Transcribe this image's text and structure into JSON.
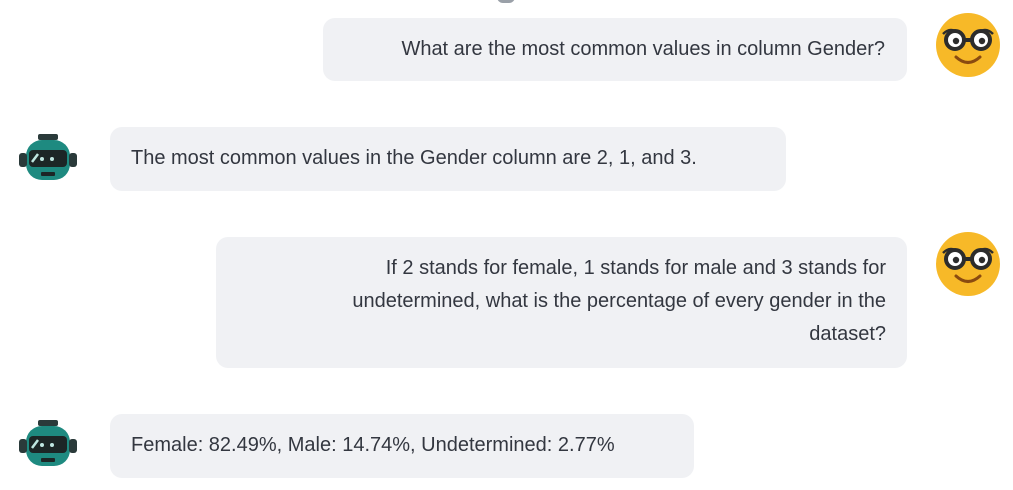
{
  "conversation": {
    "messages": [
      {
        "role": "user",
        "text": "What are the most common values in column Gender?"
      },
      {
        "role": "assistant",
        "text": "The most common values in the Gender column are 2, 1, and 3."
      },
      {
        "role": "user",
        "lines": [
          "If 2 stands for female, 1 stands for male and 3 stands for",
          "undetermined, what is the percentage of every gender in the",
          "dataset?"
        ]
      },
      {
        "role": "assistant",
        "text": "Female: 82.49%, Male: 14.74%, Undetermined: 2.77%"
      }
    ]
  },
  "avatars": {
    "user": {
      "icon": "nerd-face-icon",
      "color": "#f7b928"
    },
    "assistant": {
      "icon": "robot-icon",
      "color": "#1e8a80"
    }
  }
}
